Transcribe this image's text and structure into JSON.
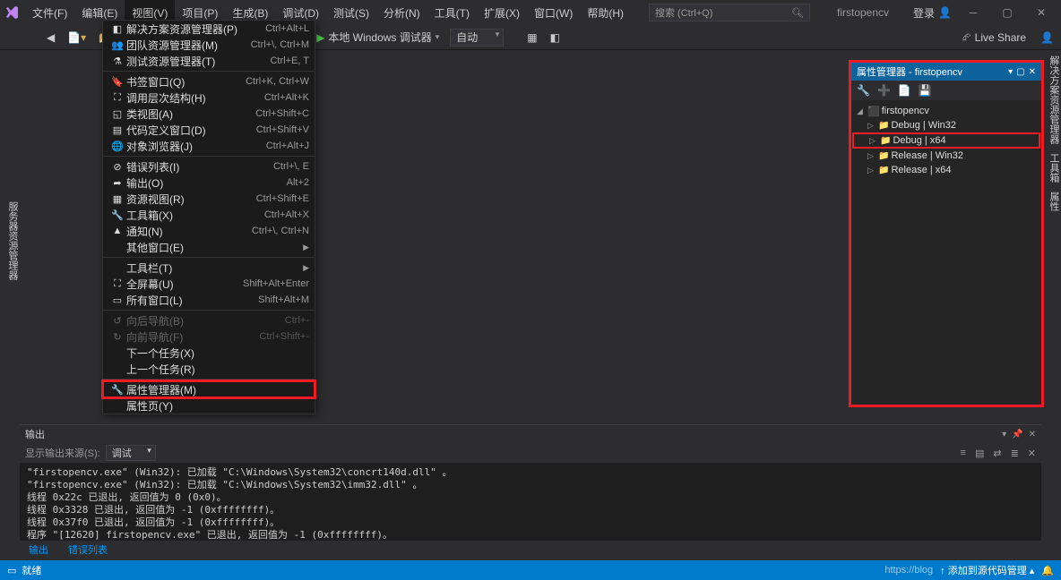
{
  "menubar": {
    "file": "文件(F)",
    "edit": "编辑(E)",
    "view": "视图(V)",
    "project": "项目(P)",
    "build": "生成(B)",
    "debug": "调试(D)",
    "test": "测试(S)",
    "analyze": "分析(N)",
    "tools": "工具(T)",
    "extensions": "扩展(X)",
    "window": "窗口(W)",
    "help": "帮助(H)"
  },
  "search": {
    "placeholder": "搜索 (Ctrl+Q)"
  },
  "project_name": "firstopencv",
  "login": "登录",
  "toolbar": {
    "debugger": "本地 Windows 调试器",
    "config": "自动"
  },
  "liveshare": "Live Share",
  "left_rail": "服务器资源管理器",
  "right_rail": {
    "a": "解决方案资源管理器",
    "b": "工具箱",
    "c": "属性"
  },
  "view_menu": {
    "items": [
      {
        "icon": "◧",
        "label": "解决方案资源管理器(P)",
        "sc": "Ctrl+Alt+L"
      },
      {
        "icon": "👥",
        "label": "团队资源管理器(M)",
        "sc": "Ctrl+\\, Ctrl+M"
      },
      {
        "icon": "⚗",
        "label": "测试资源管理器(T)",
        "sc": "Ctrl+E, T"
      },
      {
        "sep": true
      },
      {
        "icon": "🔖",
        "label": "书签窗口(Q)",
        "sc": "Ctrl+K, Ctrl+W"
      },
      {
        "icon": "⛶",
        "label": "调用层次结构(H)",
        "sc": "Ctrl+Alt+K"
      },
      {
        "icon": "◱",
        "label": "类视图(A)",
        "sc": "Ctrl+Shift+C"
      },
      {
        "icon": "▤",
        "label": "代码定义窗口(D)",
        "sc": "Ctrl+Shift+V"
      },
      {
        "icon": "🌐",
        "label": "对象浏览器(J)",
        "sc": "Ctrl+Alt+J"
      },
      {
        "sep": true
      },
      {
        "icon": "⊘",
        "label": "错误列表(I)",
        "sc": "Ctrl+\\, E"
      },
      {
        "icon": "➦",
        "label": "输出(O)",
        "sc": "Alt+2"
      },
      {
        "icon": "▦",
        "label": "资源视图(R)",
        "sc": "Ctrl+Shift+E"
      },
      {
        "icon": "🔧",
        "label": "工具箱(X)",
        "sc": "Ctrl+Alt+X"
      },
      {
        "icon": "▲",
        "label": "通知(N)",
        "sc": "Ctrl+\\, Ctrl+N"
      },
      {
        "icon": "",
        "label": "其他窗口(E)",
        "sc": "",
        "sub": true
      },
      {
        "sep": true
      },
      {
        "icon": "",
        "label": "工具栏(T)",
        "sc": "",
        "sub": true
      },
      {
        "icon": "⛶",
        "label": "全屏幕(U)",
        "sc": "Shift+Alt+Enter"
      },
      {
        "icon": "▭",
        "label": "所有窗口(L)",
        "sc": "Shift+Alt+M"
      },
      {
        "sep": true
      },
      {
        "icon": "↺",
        "label": "向后导航(B)",
        "sc": "Ctrl+-",
        "disabled": true
      },
      {
        "icon": "↻",
        "label": "向前导航(F)",
        "sc": "Ctrl+Shift+-",
        "disabled": true
      },
      {
        "icon": "",
        "label": "下一个任务(X)",
        "sc": ""
      },
      {
        "icon": "",
        "label": "上一个任务(R)",
        "sc": ""
      },
      {
        "sep": true
      },
      {
        "icon": "🔧",
        "label": "属性管理器(M)",
        "sc": "",
        "hl": true
      },
      {
        "icon": "",
        "label": "属性页(Y)",
        "sc": ""
      }
    ]
  },
  "prop_panel": {
    "title": "属性管理器 - firstopencv",
    "tree": {
      "root": "firstopencv",
      "items": [
        {
          "label": "Debug | Win32"
        },
        {
          "label": "Debug | x64",
          "hl": true
        },
        {
          "label": "Release | Win32"
        },
        {
          "label": "Release | x64"
        }
      ]
    }
  },
  "output": {
    "title": "输出",
    "src_label": "显示输出来源(S):",
    "src_value": "调试",
    "lines": "\"firstopencv.exe\" (Win32): 已加载 \"C:\\Windows\\System32\\concrt140d.dll\" 。\n\"firstopencv.exe\" (Win32): 已加载 \"C:\\Windows\\System32\\imm32.dll\" 。\n线程 0x22c 已退出, 返回值为 0 (0x0)。\n线程 0x3328 已退出, 返回值为 -1 (0xffffffff)。\n线程 0x37f0 已退出, 返回值为 -1 (0xffffffff)。\n程序 \"[12620] firstopencv.exe\" 已退出, 返回值为 -1 (0xffffffff)。"
  },
  "bottom_tabs": {
    "a": "输出",
    "b": "错误列表"
  },
  "status": {
    "ready": "就绪",
    "add": "添加到源代码管理",
    "blog": "https://blog"
  }
}
